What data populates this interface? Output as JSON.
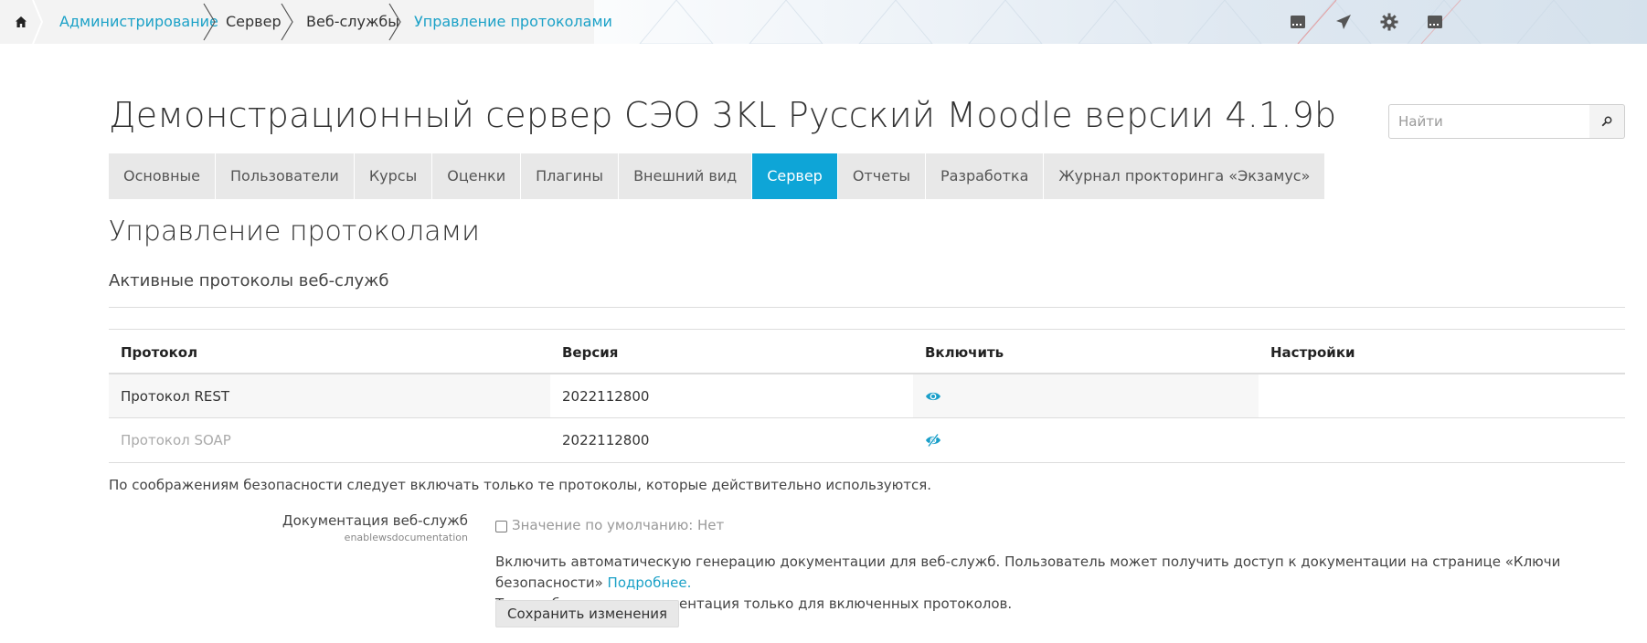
{
  "breadcrumb": {
    "items": [
      {
        "label": "Администрирование"
      },
      {
        "label": "Сервер"
      },
      {
        "label": "Веб-службы"
      },
      {
        "label": "Управление протоколами"
      }
    ]
  },
  "header": {
    "site_title": "Демонстрационный сервер СЭО 3KL Русский Moodle версии 4.1.9b",
    "search_placeholder": "Найти"
  },
  "tabs": [
    {
      "label": "Основные"
    },
    {
      "label": "Пользователи"
    },
    {
      "label": "Курсы"
    },
    {
      "label": "Оценки"
    },
    {
      "label": "Плагины"
    },
    {
      "label": "Внешний вид"
    },
    {
      "label": "Сервер"
    },
    {
      "label": "Отчеты"
    },
    {
      "label": "Разработка"
    },
    {
      "label": "Журнал прокторинга «Экзамус»"
    }
  ],
  "active_tab": "Сервер",
  "colors": {
    "accent": "#0ea5d7",
    "link": "#1ba1c7"
  },
  "main": {
    "page_heading": "Управление протоколами",
    "section_heading": "Активные протоколы веб-служб",
    "table": {
      "headers": [
        "Протокол",
        "Версия",
        "Включить",
        "Настройки"
      ],
      "rows": [
        {
          "protocol": "Протокол REST",
          "version": "2022112800",
          "enabled_icon": "eye-icon",
          "enabled": true
        },
        {
          "protocol": "Протокол SOAP",
          "version": "2022112800",
          "enabled_icon": "eye-slash-icon",
          "enabled": false
        }
      ]
    },
    "security_note": "По соображениям безопасности следует включать только те протоколы, которые действительно используются.",
    "setting": {
      "label": "Документация веб-служб",
      "name": "enablewsdocumentation",
      "default_value": "Значение по умолчанию: Нет",
      "description": "Включить автоматическую генерацию документации для веб-служб. Пользователь может получить доступ к документации на странице «Ключи безопасности» ",
      "more_link": "Подробнее.",
      "description_line2": "Там отображается документация только для включенных протоколов."
    },
    "save_button": "Сохранить изменения"
  }
}
